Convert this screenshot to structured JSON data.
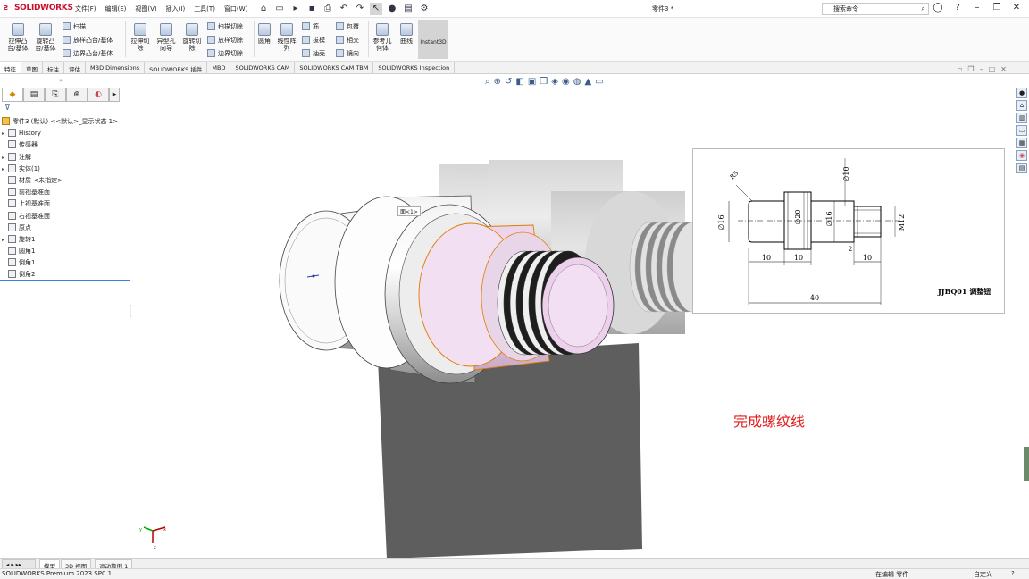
{
  "app": {
    "name": "SOLIDWORKS",
    "doc_title": "零件3 *"
  },
  "menu": [
    "文件(F)",
    "编辑(E)",
    "视图(V)",
    "插入(I)",
    "工具(T)",
    "窗口(W)"
  ],
  "search": {
    "placeholder": "搜索命令"
  },
  "ribbon": {
    "extrude_boss": "拉伸凸\n台/基体",
    "revolve_boss": "旋转凸\n台/基体",
    "sweep": "扫描",
    "loft": "放样凸台/基体",
    "boundary": "边界凸台/基体",
    "extrude_cut": "拉伸切\n除",
    "hole_wizard": "异型孔\n向导",
    "revolve_cut": "旋转切\n除",
    "swept_cut": "扫描切除",
    "lofted_cut": "放样切除",
    "boundary_cut": "边界切除",
    "fillet": "圆角",
    "linear_pattern": "线性阵\n列",
    "rib": "筋",
    "draft": "拔模",
    "shell": "抽壳",
    "wrap": "包覆",
    "intersect": "相交",
    "mirror": "镜向",
    "ref_geometry": "参考几\n何体",
    "curves": "曲线",
    "instant3d": "Instant3D"
  },
  "tabs": [
    "特征",
    "草图",
    "标注",
    "评估",
    "MBD Dimensions",
    "SOLIDWORKS 插件",
    "MBD",
    "SOLIDWORKS CAM",
    "SOLIDWORKS CAM TBM",
    "SOLIDWORKS Inspection"
  ],
  "tree": {
    "root": "零件3 (默认) <<默认>_显示状态 1>",
    "items": [
      {
        "label": "History",
        "icon": "history-icon",
        "expand": true
      },
      {
        "label": "传感器",
        "icon": "sensor-icon",
        "expand": false
      },
      {
        "label": "注解",
        "icon": "annotation-icon",
        "expand": true
      },
      {
        "label": "实体(1)",
        "icon": "solid-body-icon",
        "expand": true
      },
      {
        "label": "材质 <未指定>",
        "icon": "material-icon",
        "expand": false
      },
      {
        "label": "前视基准面",
        "icon": "plane-icon",
        "expand": false
      },
      {
        "label": "上视基准面",
        "icon": "plane-icon",
        "expand": false
      },
      {
        "label": "右视基准面",
        "icon": "plane-icon",
        "expand": false
      },
      {
        "label": "原点",
        "icon": "origin-icon",
        "expand": false
      },
      {
        "label": "旋转1",
        "icon": "revolve-icon",
        "expand": true
      },
      {
        "label": "圆角1",
        "icon": "fillet-icon",
        "expand": false
      },
      {
        "label": "倒角1",
        "icon": "chamfer-icon",
        "expand": false
      },
      {
        "label": "倒角2",
        "icon": "chamfer-icon",
        "expand": false
      }
    ]
  },
  "viewport": {
    "tooltip": "面<1>",
    "note": "完成螺纹线",
    "drawing": {
      "title": "JJBQ01 调整钮",
      "dims": {
        "chamfer": "R5",
        "d16_left": "∅16",
        "d20": "∅20",
        "d16_mid": "∅16",
        "d10": "∅10",
        "m12": "M12",
        "l10a": "10",
        "l10b": "10",
        "l2": "2",
        "l10c": "10",
        "l40": "40"
      }
    }
  },
  "bottom_tabs": [
    "模型",
    "3D 视图",
    "运动算例 1"
  ],
  "status": {
    "left": "SOLIDWORKS Premium 2023 SP0.1",
    "mode": "在编辑 零件",
    "units": "自定义"
  }
}
